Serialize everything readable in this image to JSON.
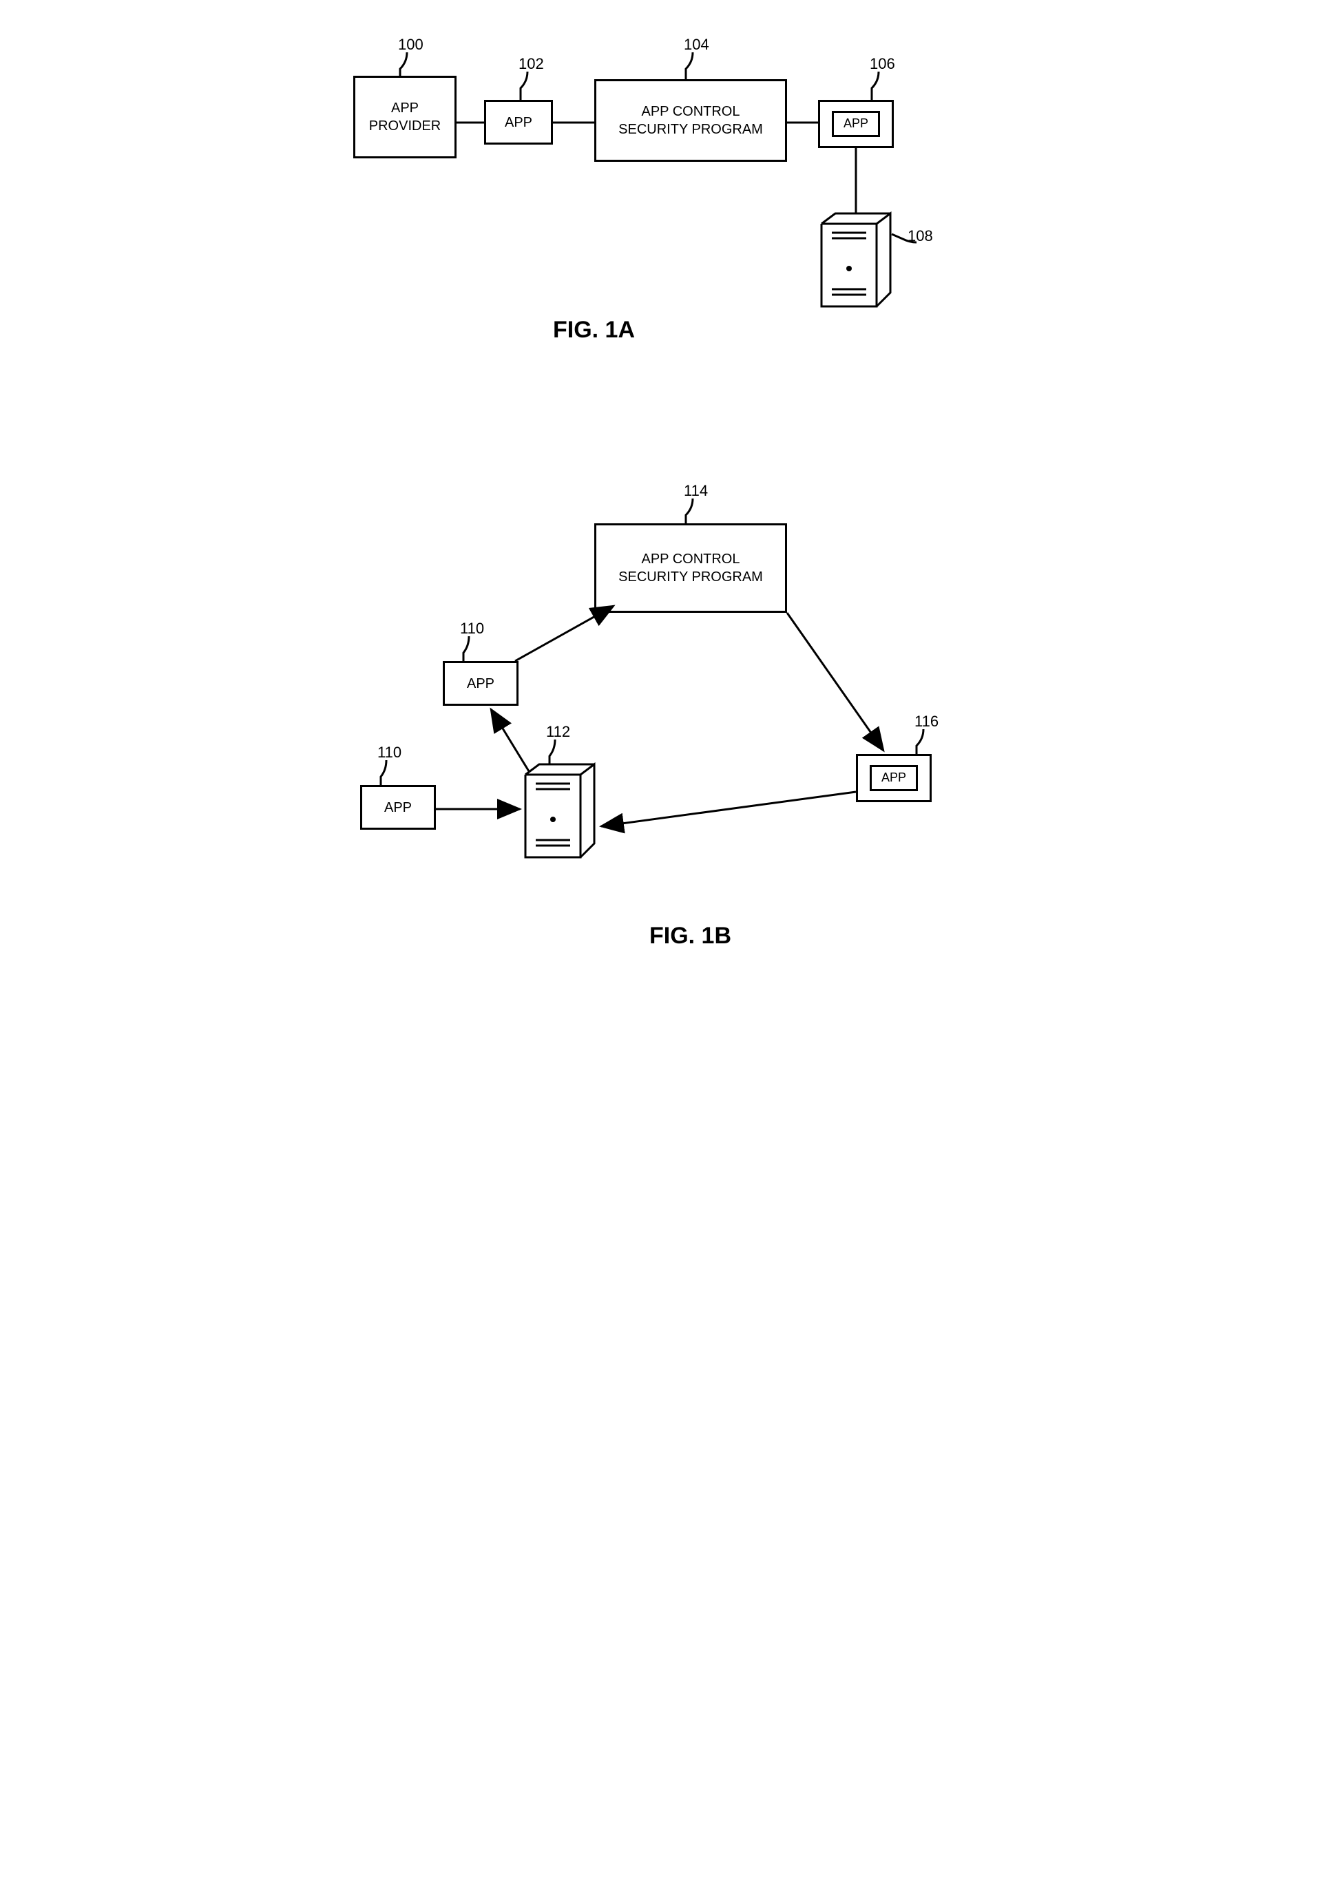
{
  "figA": {
    "title": "FIG. 1A",
    "blocks": {
      "provider": {
        "label": "APP\nPROVIDER",
        "ref": "100"
      },
      "app": {
        "label": "APP",
        "ref": "102"
      },
      "program": {
        "label": "APP CONTROL\nSECURITY PROGRAM",
        "ref": "104"
      },
      "device": {
        "label": "APP",
        "ref": "106"
      },
      "server": {
        "ref": "108"
      }
    }
  },
  "figB": {
    "title": "FIG. 1B",
    "blocks": {
      "app1": {
        "label": "APP",
        "ref": "110"
      },
      "app2": {
        "label": "APP",
        "ref": "110"
      },
      "server": {
        "ref": "112"
      },
      "program": {
        "label": "APP CONTROL\nSECURITY PROGRAM",
        "ref": "114"
      },
      "device": {
        "label": "APP",
        "ref": "116"
      }
    }
  }
}
